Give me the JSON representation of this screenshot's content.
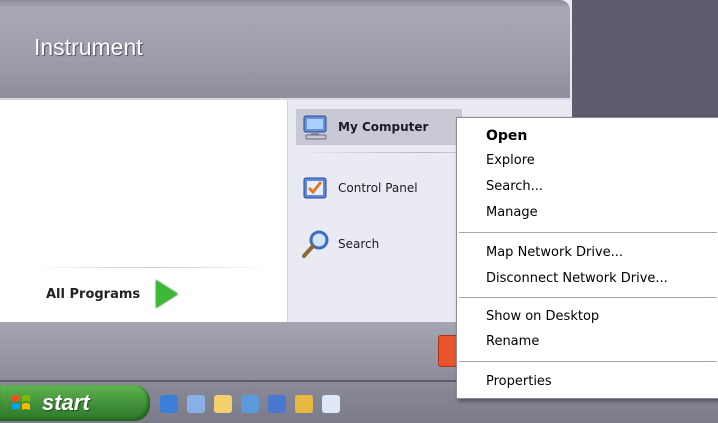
{
  "start_menu": {
    "user_name": "Instrument",
    "all_programs_label": "All Programs",
    "right_items": [
      {
        "label": "My Computer",
        "icon": "my-computer-icon"
      },
      {
        "label": "Control Panel",
        "icon": "control-panel-icon"
      },
      {
        "label": "Search",
        "icon": "search-icon"
      }
    ]
  },
  "taskbar": {
    "start_label": "start",
    "quick_launch_icons": [
      "internet-explorer-icon",
      "calculator-icon",
      "folder-icon",
      "media-icon",
      "display-icon",
      "paint-icon",
      "notepad-icon"
    ]
  },
  "context_menu": {
    "items": [
      {
        "label": "Open"
      },
      {
        "label": "Explore"
      },
      {
        "label": "Search..."
      },
      {
        "label": "Manage"
      },
      {
        "label": "Map Network Drive..."
      },
      {
        "label": "Disconnect Network Drive..."
      },
      {
        "label": "Show on Desktop"
      },
      {
        "label": "Rename"
      },
      {
        "label": "Properties"
      }
    ]
  },
  "colors": {
    "desktop": "#5e5d6e",
    "start_button": "#3d8b36",
    "highlight": "#c9c9d6"
  }
}
